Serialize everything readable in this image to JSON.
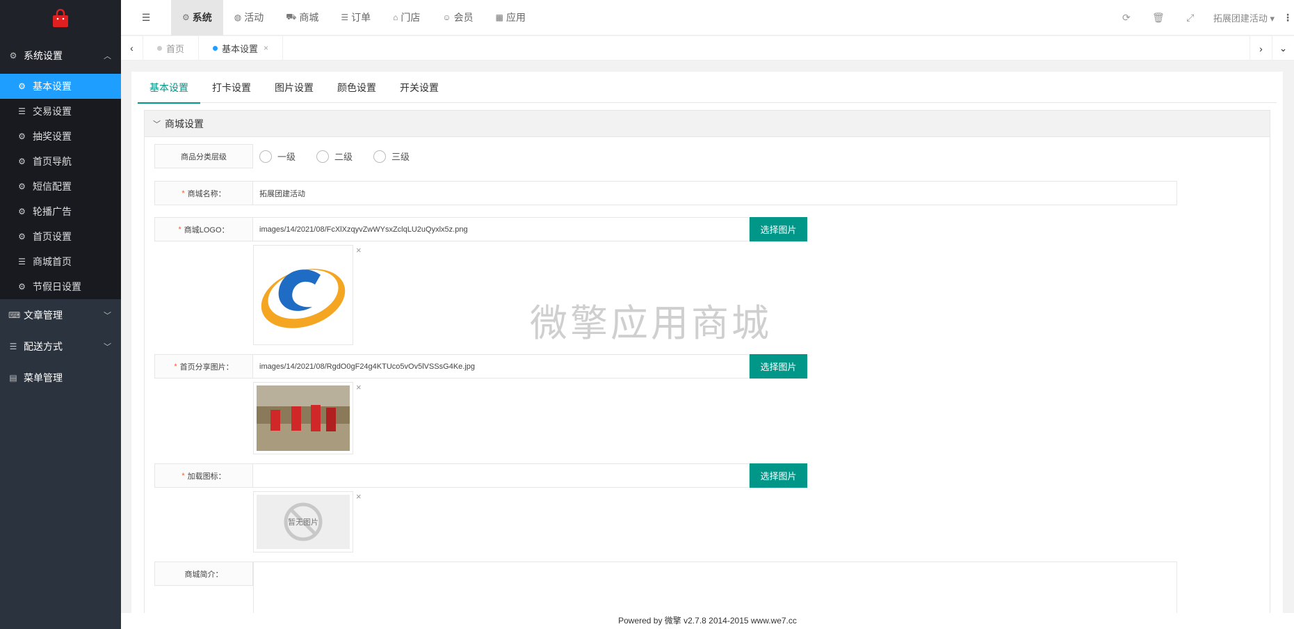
{
  "sidebar": {
    "group_open": {
      "label": "系统设置",
      "icon": "gear-icon"
    },
    "items": [
      {
        "label": "基本设置",
        "icon": "gear-icon",
        "active": true
      },
      {
        "label": "交易设置",
        "icon": "list-icon"
      },
      {
        "label": "抽奖设置",
        "icon": "gear-icon"
      },
      {
        "label": "首页导航",
        "icon": "gear-icon"
      },
      {
        "label": "短信配置",
        "icon": "gear-icon"
      },
      {
        "label": "轮播广告",
        "icon": "gear-icon"
      },
      {
        "label": "首页设置",
        "icon": "gear-icon"
      },
      {
        "label": "商城首页",
        "icon": "list-icon"
      },
      {
        "label": "节假日设置",
        "icon": "gear-icon"
      }
    ],
    "groups": [
      {
        "label": "文章管理",
        "icon": "keyboard-icon"
      },
      {
        "label": "配送方式",
        "icon": "list-icon"
      },
      {
        "label": "菜单管理",
        "icon": "table-icon"
      }
    ]
  },
  "topnav": {
    "items": [
      {
        "label": "系统",
        "icon": "gears-icon",
        "active": true
      },
      {
        "label": "活动",
        "icon": "globe-icon"
      },
      {
        "label": "商城",
        "icon": "cart-icon"
      },
      {
        "label": "订单",
        "icon": "list-icon"
      },
      {
        "label": "门店",
        "icon": "bank-icon"
      },
      {
        "label": "会员",
        "icon": "users-icon"
      },
      {
        "label": "应用",
        "icon": "grid-icon"
      }
    ],
    "account": "拓展团建活动"
  },
  "tabs": {
    "items": [
      {
        "label": "首页"
      },
      {
        "label": "基本设置",
        "active": true
      }
    ]
  },
  "subtabs": [
    "基本设置",
    "打卡设置",
    "图片设置",
    "颜色设置",
    "开关设置"
  ],
  "section": {
    "title": "商城设置",
    "category_level": {
      "label": "商品分类层级",
      "options": [
        "一级",
        "二级",
        "三级"
      ]
    },
    "shop_name": {
      "label": "商城名称：",
      "value": "拓展团建活动"
    },
    "logo": {
      "label": "商城LOGO：",
      "value": "images/14/2021/08/FcXlXzqyvZwWYsxZclqLU2uQyxlx5z.png",
      "button": "选择图片"
    },
    "share_image": {
      "label": "首页分享图片：",
      "value": "images/14/2021/08/RgdO0gF24g4KTUco5vOv5lVSSsG4Ke.jpg",
      "button": "选择图片"
    },
    "loading_icon": {
      "label": "加载图标：",
      "value": "",
      "button": "选择图片",
      "empty_text": "暂无图片"
    },
    "intro": {
      "label": "商城简介："
    }
  },
  "watermark": "微擎应用商城",
  "footer": "Powered by 微擎 v2.7.8 2014-2015 www.we7.cc",
  "colors": {
    "accent": "#009688",
    "active_blue": "#1e9fff",
    "sidebar": "#2b333e"
  }
}
